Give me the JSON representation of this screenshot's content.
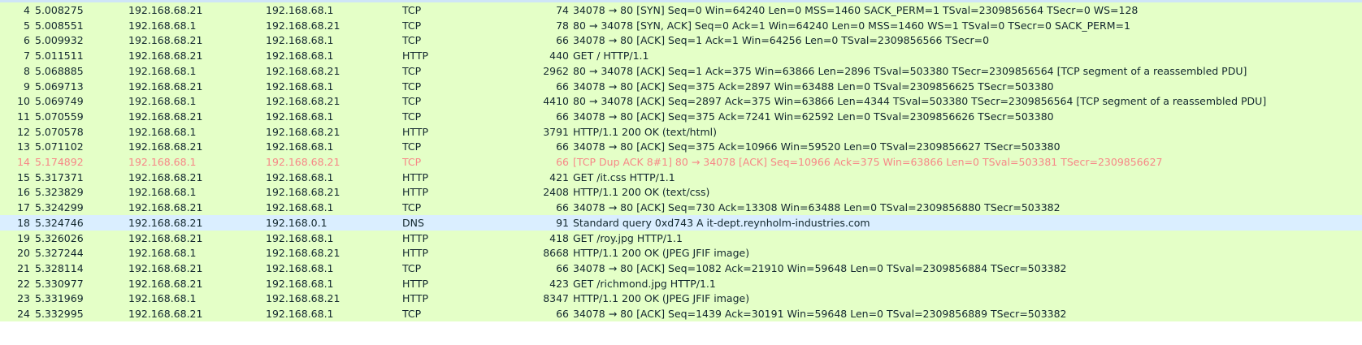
{
  "packets": [
    {
      "no": "4",
      "time": "5.008275",
      "src": "192.168.68.21",
      "dst": "192.168.68.1",
      "proto": "TCP",
      "len": "74",
      "info": "34078 → 80 [SYN] Seq=0 Win=64240 Len=0 MSS=1460 SACK_PERM=1 TSval=2309856564 TSecr=0 WS=128"
    },
    {
      "no": "5",
      "time": "5.008551",
      "src": "192.168.68.1",
      "dst": "192.168.68.21",
      "proto": "TCP",
      "len": "78",
      "info": "80 → 34078 [SYN, ACK] Seq=0 Ack=1 Win=64240 Len=0 MSS=1460 WS=1 TSval=0 TSecr=0 SACK_PERM=1"
    },
    {
      "no": "6",
      "time": "5.009932",
      "src": "192.168.68.21",
      "dst": "192.168.68.1",
      "proto": "TCP",
      "len": "66",
      "info": "34078 → 80 [ACK] Seq=1 Ack=1 Win=64256 Len=0 TSval=2309856566 TSecr=0"
    },
    {
      "no": "7",
      "time": "5.011511",
      "src": "192.168.68.21",
      "dst": "192.168.68.1",
      "proto": "HTTP",
      "len": "440",
      "info": "GET / HTTP/1.1"
    },
    {
      "no": "8",
      "time": "5.068885",
      "src": "192.168.68.1",
      "dst": "192.168.68.21",
      "proto": "TCP",
      "len": "2962",
      "info": "80 → 34078 [ACK] Seq=1 Ack=375 Win=63866 Len=2896 TSval=503380 TSecr=2309856564 [TCP segment of a reassembled PDU]"
    },
    {
      "no": "9",
      "time": "5.069713",
      "src": "192.168.68.21",
      "dst": "192.168.68.1",
      "proto": "TCP",
      "len": "66",
      "info": "34078 → 80 [ACK] Seq=375 Ack=2897 Win=63488 Len=0 TSval=2309856625 TSecr=503380"
    },
    {
      "no": "10",
      "time": "5.069749",
      "src": "192.168.68.1",
      "dst": "192.168.68.21",
      "proto": "TCP",
      "len": "4410",
      "info": "80 → 34078 [ACK] Seq=2897 Ack=375 Win=63866 Len=4344 TSval=503380 TSecr=2309856564 [TCP segment of a reassembled PDU]"
    },
    {
      "no": "11",
      "time": "5.070559",
      "src": "192.168.68.21",
      "dst": "192.168.68.1",
      "proto": "TCP",
      "len": "66",
      "info": "34078 → 80 [ACK] Seq=375 Ack=7241 Win=62592 Len=0 TSval=2309856626 TSecr=503380"
    },
    {
      "no": "12",
      "time": "5.070578",
      "src": "192.168.68.1",
      "dst": "192.168.68.21",
      "proto": "HTTP",
      "len": "3791",
      "info": "HTTP/1.1 200 OK  (text/html)"
    },
    {
      "no": "13",
      "time": "5.071102",
      "src": "192.168.68.21",
      "dst": "192.168.68.1",
      "proto": "TCP",
      "len": "66",
      "info": "34078 → 80 [ACK] Seq=375 Ack=10966 Win=59520 Len=0 TSval=2309856627 TSecr=503380"
    },
    {
      "no": "14",
      "time": "5.174892",
      "src": "192.168.68.1",
      "dst": "192.168.68.21",
      "proto": "TCP",
      "len": "66",
      "info": "[TCP Dup ACK 8#1] 80 → 34078 [ACK] Seq=10966 Ack=375 Win=63866 Len=0 TSval=503381 TSecr=2309856627"
    },
    {
      "no": "15",
      "time": "5.317371",
      "src": "192.168.68.21",
      "dst": "192.168.68.1",
      "proto": "HTTP",
      "len": "421",
      "info": "GET /it.css HTTP/1.1"
    },
    {
      "no": "16",
      "time": "5.323829",
      "src": "192.168.68.1",
      "dst": "192.168.68.21",
      "proto": "HTTP",
      "len": "2408",
      "info": "HTTP/1.1 200 OK  (text/css)"
    },
    {
      "no": "17",
      "time": "5.324299",
      "src": "192.168.68.21",
      "dst": "192.168.68.1",
      "proto": "TCP",
      "len": "66",
      "info": "34078 → 80 [ACK] Seq=730 Ack=13308 Win=63488 Len=0 TSval=2309856880 TSecr=503382"
    },
    {
      "no": "18",
      "time": "5.324746",
      "src": "192.168.68.21",
      "dst": "192.168.0.1",
      "proto": "DNS",
      "len": "91",
      "info": "Standard query 0xd743 A it-dept.reynholm-industries.com"
    },
    {
      "no": "19",
      "time": "5.326026",
      "src": "192.168.68.21",
      "dst": "192.168.68.1",
      "proto": "HTTP",
      "len": "418",
      "info": "GET /roy.jpg HTTP/1.1"
    },
    {
      "no": "20",
      "time": "5.327244",
      "src": "192.168.68.1",
      "dst": "192.168.68.21",
      "proto": "HTTP",
      "len": "8668",
      "info": "HTTP/1.1 200 OK  (JPEG JFIF image)"
    },
    {
      "no": "21",
      "time": "5.328114",
      "src": "192.168.68.21",
      "dst": "192.168.68.1",
      "proto": "TCP",
      "len": "66",
      "info": "34078 → 80 [ACK] Seq=1082 Ack=21910 Win=59648 Len=0 TSval=2309856884 TSecr=503382"
    },
    {
      "no": "22",
      "time": "5.330977",
      "src": "192.168.68.21",
      "dst": "192.168.68.1",
      "proto": "HTTP",
      "len": "423",
      "info": "GET /richmond.jpg HTTP/1.1"
    },
    {
      "no": "23",
      "time": "5.331969",
      "src": "192.168.68.1",
      "dst": "192.168.68.21",
      "proto": "HTTP",
      "len": "8347",
      "info": "HTTP/1.1 200 OK  (JPEG JFIF image)"
    },
    {
      "no": "24",
      "time": "5.332995",
      "src": "192.168.68.21",
      "dst": "192.168.68.1",
      "proto": "TCP",
      "len": "66",
      "info": "34078 → 80 [ACK] Seq=1439 Ack=30191 Win=59648 Len=0 TSval=2309856889 TSecr=503382"
    }
  ],
  "colors": {
    "tcp_row": "#e4ffc7",
    "http_row": "#e4ffc7",
    "dns_row": "#daeeff",
    "bad_row_bg": "#12272e",
    "bad_row_fg": "#f78787"
  }
}
